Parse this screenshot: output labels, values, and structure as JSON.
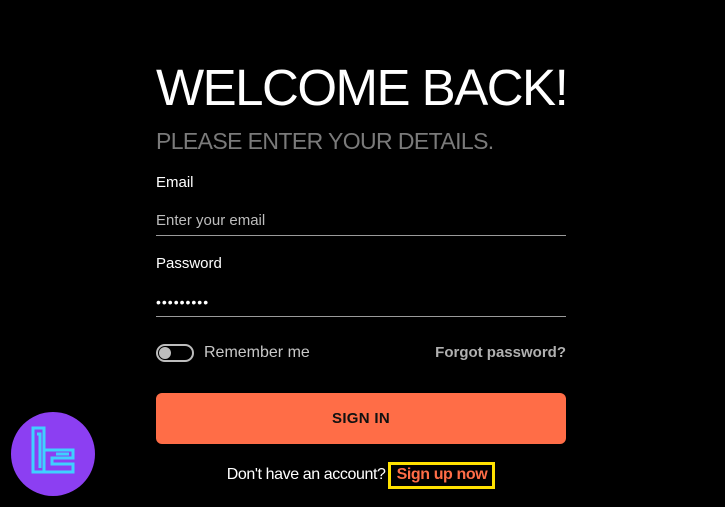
{
  "login": {
    "title": "WELCOME BACK!",
    "subtitle": "PLEASE ENTER YOUR DETAILS.",
    "email_label": "Email",
    "email_placeholder": "Enter your email",
    "email_value": "",
    "password_label": "Password",
    "password_value": "•••••••••",
    "remember_label": "Remember me",
    "remember_checked": false,
    "forgot_label": "Forgot password?",
    "sign_in_label": "SIGN IN",
    "signup_prompt": "Don't have an account?",
    "signup_link_label": "Sign up now"
  },
  "branding": {
    "logo_icon": "tradingfinder-logo-icon"
  },
  "colors": {
    "background": "#000000",
    "accent": "#ff6d47",
    "highlight_border": "#ffe100",
    "subtitle": "#7a7a7a",
    "logo_badge": "#8c3ff2",
    "logo_mark": "#3fd0ff"
  }
}
